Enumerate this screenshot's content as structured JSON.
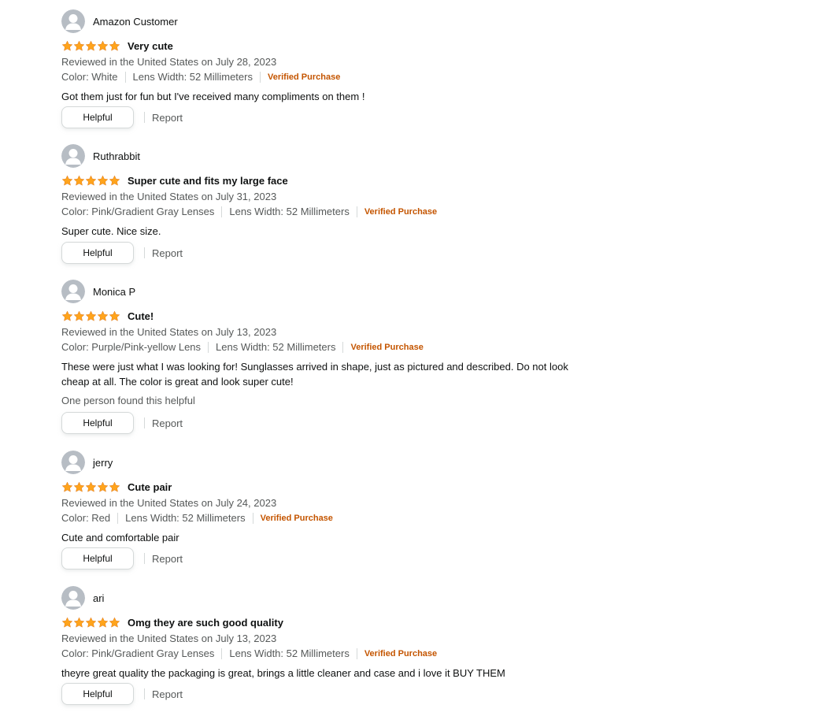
{
  "colors": {
    "star": "#FFA41C",
    "verified": "#C45500",
    "secondary_text": "#565959",
    "primary_text": "#0F1111",
    "avatar_bg": "#B7BDC4"
  },
  "icons": {
    "avatar": "avatar-silhouette-icon",
    "star": "star-icon"
  },
  "reviews": [
    {
      "author": "Amazon Customer",
      "rating": 5,
      "title": "Very cute",
      "date": "Reviewed in the United States on July 28, 2023",
      "color": "Color: White",
      "lens_width": "Lens Width: 52 Millimeters",
      "verified": "Verified Purchase",
      "body": "Got them just for fun but I've received many compliments on them !",
      "helpful_count": "",
      "helpful_label": "Helpful",
      "report_label": "Report"
    },
    {
      "author": "Ruthrabbit",
      "rating": 5,
      "title": "Super cute and fits my large face",
      "date": "Reviewed in the United States on July 31, 2023",
      "color": "Color: Pink/Gradient Gray Lenses",
      "lens_width": "Lens Width: 52 Millimeters",
      "verified": "Verified Purchase",
      "body": "Super cute. Nice size.",
      "helpful_count": "",
      "helpful_label": "Helpful",
      "report_label": "Report"
    },
    {
      "author": "Monica P",
      "rating": 5,
      "title": "Cute!",
      "date": "Reviewed in the United States on July 13, 2023",
      "color": "Color: Purple/Pink-yellow Lens",
      "lens_width": "Lens Width: 52 Millimeters",
      "verified": "Verified Purchase",
      "body": "These were just what I was looking for! Sunglasses arrived in shape, just as pictured and described. Do not look cheap at all. The color is great and look super cute!",
      "helpful_count": "One person found this helpful",
      "helpful_label": "Helpful",
      "report_label": "Report"
    },
    {
      "author": "jerry",
      "rating": 5,
      "title": "Cute pair",
      "date": "Reviewed in the United States on July 24, 2023",
      "color": "Color: Red",
      "lens_width": "Lens Width: 52 Millimeters",
      "verified": "Verified Purchase",
      "body": "Cute and comfortable pair",
      "helpful_count": "",
      "helpful_label": "Helpful",
      "report_label": "Report"
    },
    {
      "author": "ari",
      "rating": 5,
      "title": "Omg they are such good quality",
      "date": "Reviewed in the United States on July 13, 2023",
      "color": "Color: Pink/Gradient Gray Lenses",
      "lens_width": "Lens Width: 52 Millimeters",
      "verified": "Verified Purchase",
      "body": "theyre great quality the packaging is great, brings a little cleaner and case and i love it BUY THEM",
      "helpful_count": "",
      "helpful_label": "Helpful",
      "report_label": "Report"
    }
  ]
}
